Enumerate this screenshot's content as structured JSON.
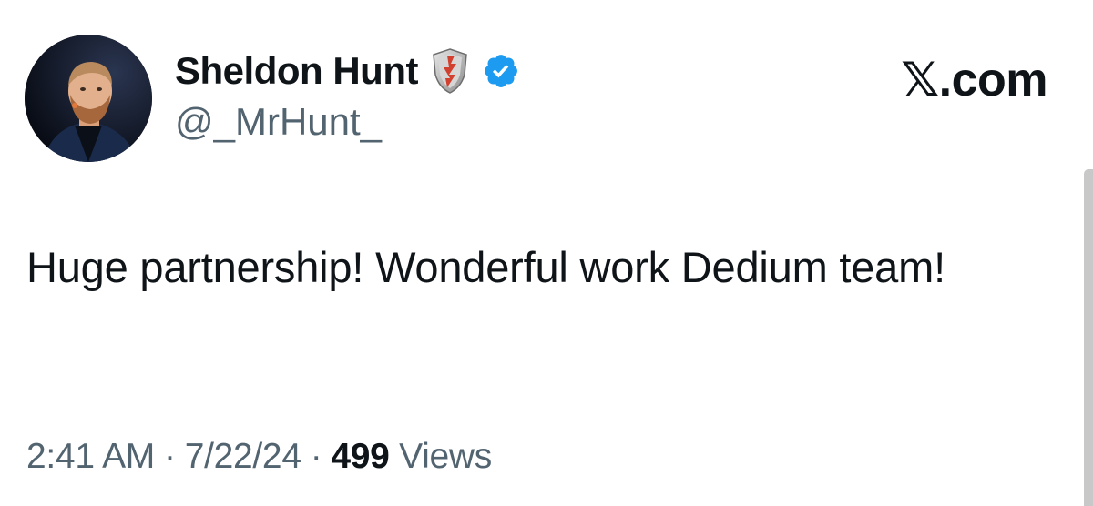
{
  "author": {
    "display_name": "Sheldon Hunt",
    "handle": "@_MrHunt_",
    "avatar_icon": "profile-photo",
    "badges": [
      "shield-icon",
      "verified-icon"
    ]
  },
  "brand": {
    "label": "𝕏.com"
  },
  "tweet": {
    "text": "Huge partnership! Wonderful work Dedium team!",
    "time": "2:41 AM",
    "date": "7/22/24",
    "separator": "·",
    "views_count": "499",
    "views_label": "Views"
  },
  "colors": {
    "text_primary": "#0f1419",
    "text_secondary": "#536471",
    "verified_blue": "#1d9bf0",
    "shield_red": "#c0392b"
  }
}
